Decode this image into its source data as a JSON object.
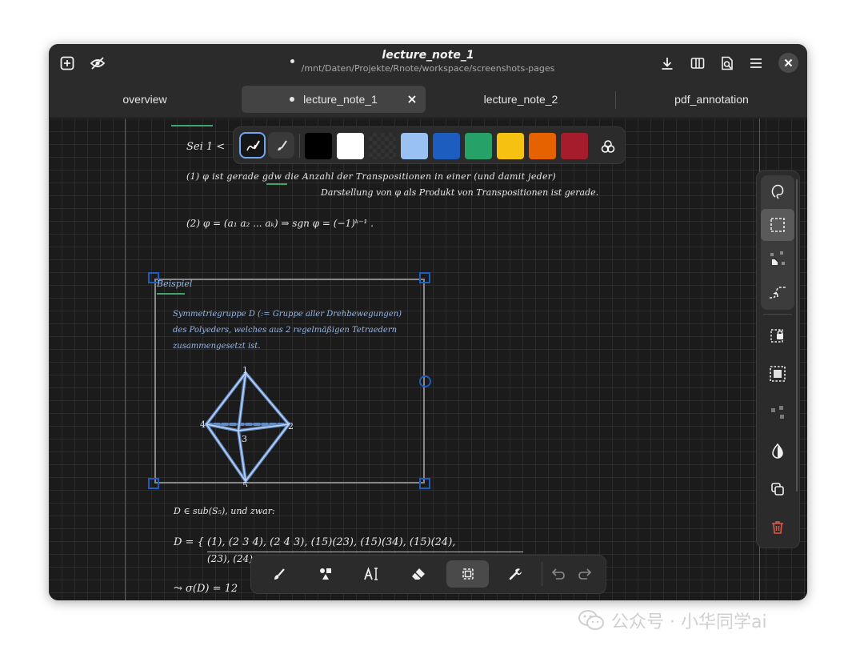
{
  "headerbar": {
    "title": "lecture_note_1",
    "subtitle": "/mnt/Daten/Projekte/Rnote/workspace/screenshots-pages",
    "left_icons": [
      "new-tab-icon",
      "hide-icon"
    ],
    "right_icons": [
      "download-icon",
      "columns-icon",
      "export-icon",
      "menu-icon",
      "close-icon"
    ]
  },
  "tabs": [
    {
      "label": "overview",
      "modified": false,
      "active": false
    },
    {
      "label": "lecture_note_1",
      "modified": true,
      "active": true
    },
    {
      "label": "lecture_note_2",
      "modified": false,
      "active": false
    },
    {
      "label": "pdf_annotation",
      "modified": false,
      "active": false
    }
  ],
  "palette": {
    "tools": [
      "pen-style-icon",
      "brush-style-icon"
    ],
    "colors": [
      "#000000",
      "#ffffff",
      "transparent",
      "#99c1f1",
      "#1c5dbf",
      "#26a269",
      "#f5c211",
      "#e66100",
      "#a51d2d"
    ],
    "more_icon": "color-picker-icon"
  },
  "sidebar": {
    "tools": [
      "lasso-icon",
      "rectangle-select-icon",
      "single-select-icon",
      "intersect-path-icon",
      "lock-icon",
      "select-all-icon",
      "deselect-icon",
      "invert-color-icon",
      "duplicate-icon",
      "trash-icon"
    ],
    "selected_index": 1
  },
  "bottombar": {
    "tools": [
      "pen-icon",
      "shapes-icon",
      "text-icon",
      "eraser-icon",
      "selector-icon",
      "tools-icon"
    ],
    "selected_index": 4,
    "history": [
      "undo-icon",
      "redo-icon"
    ]
  },
  "document": {
    "line_top": "Sei 1 <",
    "item1_line1": "(1)   φ ist gerade  gdw  die Anzahl der Transpositionen in einer (und damit jeder)",
    "item1_line2": "Darstellung von φ als Produkt von Transpositionen ist gerade.",
    "item2": "(2)   φ = (a₁ a₂ ... aₖ)  ⇒  sgn φ = (−1)ᵏ⁻¹ .",
    "example_label": "Beispiel",
    "example_text_1": "Symmetriegruppe  D  (:= Gruppe aller Drehbewegungen)",
    "example_text_2": "des Polyeders, welches aus 2 regelmäßigen Tetraedern",
    "example_text_3": "zusammengesetzt ist.",
    "vertex_labels": [
      "1",
      "2",
      "3",
      "4",
      "5"
    ],
    "line_d1": "D ∈ sub(S₅), und zwar:",
    "line_d2": "D = { (1), (2 3 4), (2 4 3), (15)(23), (15)(34), (15)(24),",
    "line_d3": "(23), (24), ...",
    "line_d4": "⤳ σ(D) = 12"
  },
  "watermark": "公众号 · 小华同学ai"
}
